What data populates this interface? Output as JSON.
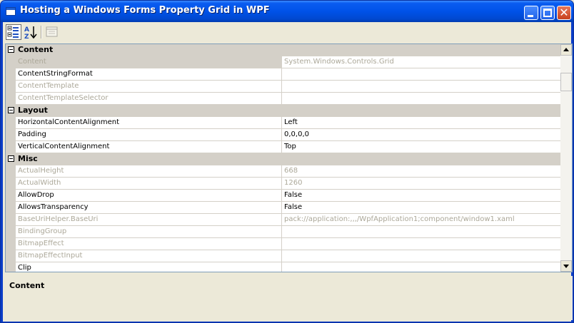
{
  "window": {
    "title": "Hosting a Windows Forms Property Grid in WPF"
  },
  "toolbar": {
    "categorized_icon": "categorized-icon",
    "alphabetical_icon": "alphabetical-icon",
    "property_pages_icon": "property-pages-icon"
  },
  "grid": {
    "categories": [
      {
        "name": "Content",
        "properties": [
          {
            "name": "Content",
            "value": "System.Windows.Controls.Grid",
            "readonly": true,
            "selected": true
          },
          {
            "name": "ContentStringFormat",
            "value": "",
            "readonly": false
          },
          {
            "name": "ContentTemplate",
            "value": "",
            "readonly": true
          },
          {
            "name": "ContentTemplateSelector",
            "value": "",
            "readonly": true
          }
        ]
      },
      {
        "name": "Layout",
        "properties": [
          {
            "name": "HorizontalContentAlignment",
            "value": "Left",
            "readonly": false
          },
          {
            "name": "Padding",
            "value": "0,0,0,0",
            "readonly": false
          },
          {
            "name": "VerticalContentAlignment",
            "value": "Top",
            "readonly": false
          }
        ]
      },
      {
        "name": "Misc",
        "properties": [
          {
            "name": "ActualHeight",
            "value": "668",
            "readonly": true
          },
          {
            "name": "ActualWidth",
            "value": "1260",
            "readonly": true
          },
          {
            "name": "AllowDrop",
            "value": "False",
            "readonly": false
          },
          {
            "name": "AllowsTransparency",
            "value": "False",
            "readonly": false
          },
          {
            "name": "BaseUriHelper.BaseUri",
            "value": "pack://application:,,,/WpfApplication1;component/window1.xaml",
            "readonly": true
          },
          {
            "name": "BindingGroup",
            "value": "",
            "readonly": true
          },
          {
            "name": "BitmapEffect",
            "value": "",
            "readonly": true
          },
          {
            "name": "BitmapEffectInput",
            "value": "",
            "readonly": true
          },
          {
            "name": "Clip",
            "value": "",
            "readonly": false
          }
        ]
      }
    ]
  },
  "description": {
    "title": "Content"
  },
  "colors": {
    "title_bar": "#0052e8",
    "category_bg": "#d4d0c8",
    "readonly_text": "#aca899",
    "face": "#ece9d8"
  }
}
